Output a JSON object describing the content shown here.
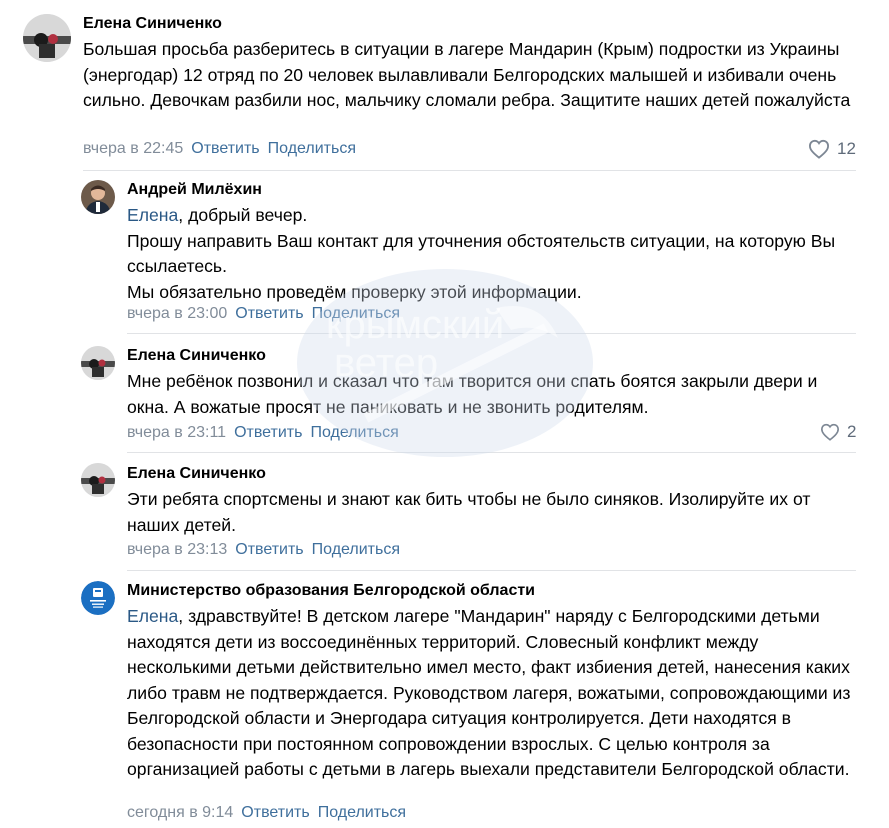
{
  "comments": [
    {
      "author": "Елена Синиченко",
      "text": "Большая просьба разберитесь в ситуации в лагере Мандарин (Крым) подростки из Украины (энергодар) 12 отряд по 20 человек вылавливали Белгородских малышей и избивали очень сильно. Девочкам разбили нос, мальчику сломали ребра. Защитите наших детей пожалуйста",
      "time": "вчера в 22:45",
      "reply": "Ответить",
      "share": "Поделиться",
      "likes": "12"
    },
    {
      "author": "Андрей Милёхин",
      "mention": "Елена",
      "text_rest": ", добрый вечер.",
      "line2": "Прошу направить Ваш контакт для уточнения обстоятельств ситуации, на которую Вы ссылаетесь.",
      "line3": "Мы обязательно проведём проверку этой информации.",
      "time": "вчера в 23:00",
      "reply": "Ответить",
      "share": "Поделиться"
    },
    {
      "author": "Елена Синиченко",
      "text": "Мне ребёнок позвонил и сказал что там творится они спать боятся закрыли двери и окна. А вожатые просят не паниковать и не звонить родителям.",
      "time": "вчера в 23:11",
      "reply": "Ответить",
      "share": "Поделиться",
      "likes": "2"
    },
    {
      "author": "Елена Синиченко",
      "text": "Эти ребята спортсмены и знают как бить чтобы не было синяков. Изолируйте их от наших детей.",
      "time": "вчера в 23:13",
      "reply": "Ответить",
      "share": "Поделиться"
    },
    {
      "author": "Министерство образования Белгородской области",
      "mention": "Елена",
      "text_rest": ", здравствуйте! В детском лагере \"Мандарин\" наряду с Белгородскими детьми находятся дети из воссоединённых территорий. Словесный конфликт между несколькими детьми действительно имел место, факт избиения детей, нанесения каких либо травм не подтверждается. Руководством лагеря, вожатыми, сопровождающими из Белгородской области и Энергодара ситуация контролируется. Дети находятся в безопасности при постоянном сопровождении взрослых. С целью контроля за организацией работы с детьми в лагерь выехали представители Белгородской области.",
      "time": "сегодня в 9:14",
      "reply": "Ответить",
      "share": "Поделиться"
    }
  ],
  "watermark": {
    "line1": "крымский",
    "line2": "ветер"
  },
  "colors": {
    "link": "#3f6f9c",
    "mention": "#2a5885",
    "meta": "#818c99",
    "divider": "#e1e3e6"
  }
}
